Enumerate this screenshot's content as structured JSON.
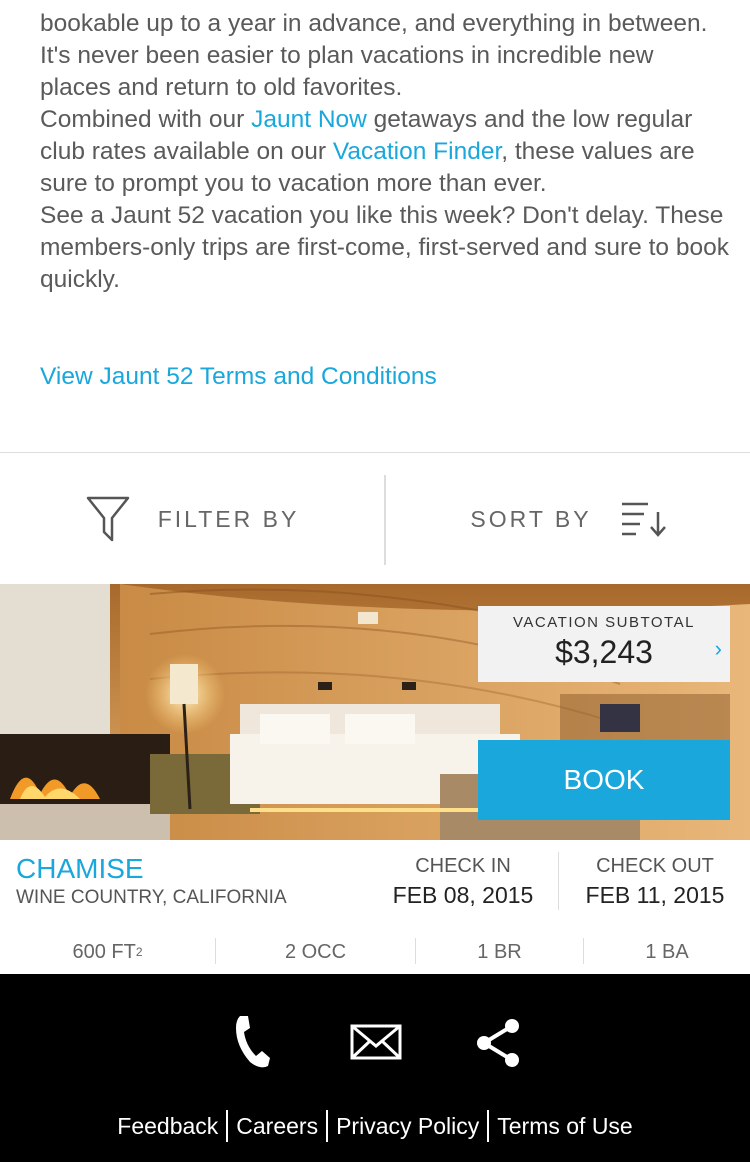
{
  "intro": {
    "line1": "bookable up to a year in advance, and everything in between.  It's never been easier to plan vacations in incredible new places and return to old favorites.",
    "line2_pre": "Combined with our ",
    "jaunt_now": "Jaunt Now",
    "line2_mid": " getaways and the low regular club rates available on our ",
    "vacation_finder": "Vacation Finder",
    "line2_post": ", these values are sure to prompt you to vacation more than ever.",
    "line3": "See a Jaunt 52 vacation you like this week? Don't delay. These members-only trips are first-come, first-served and sure to book quickly.",
    "terms_link": "View Jaunt 52 Terms and Conditions"
  },
  "toolbar": {
    "filter_label": "FILTER BY",
    "sort_label": "SORT BY"
  },
  "listing": {
    "subtotal_label": "VACATION SUBTOTAL",
    "subtotal_value": "$3,243",
    "book_label": "BOOK",
    "name": "CHAMISE",
    "location": "WINE COUNTRY, CALIFORNIA",
    "check_in_label": "CHECK IN",
    "check_in_date": "FEB 08, 2015",
    "check_out_label": "CHECK OUT",
    "check_out_date": "FEB 11, 2015",
    "stats": {
      "area": "600 FT",
      "area_sup": "2",
      "occ": "2 OCC",
      "br": "1 BR",
      "ba": "1 BA"
    }
  },
  "footer": {
    "icons": [
      "phone-icon",
      "mail-icon",
      "share-icon"
    ],
    "links": [
      "Feedback",
      "Careers",
      "Privacy Policy",
      "Terms of Use"
    ]
  },
  "colors": {
    "accent": "#19a7dc",
    "footer_bg": "#000000"
  }
}
